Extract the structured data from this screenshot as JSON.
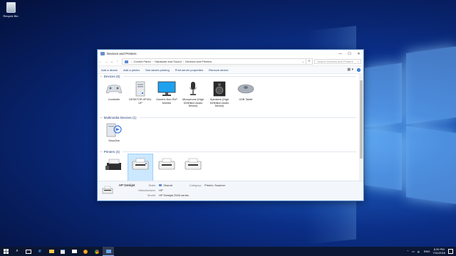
{
  "desktop": {
    "recycle_bin_label": "Recycle Bin"
  },
  "window": {
    "title": "Devices and Printers",
    "controls": {
      "minimize": "—",
      "maximize": "☐",
      "close": "✕"
    },
    "breadcrumb": [
      "Control Panel",
      "Hardware and Sound",
      "Devices and Printers"
    ],
    "search_placeholder": "Search Devices and Printers",
    "toolbar": [
      "Add a device",
      "Add a printer",
      "See what's printing",
      "Print server properties",
      "Remove device"
    ],
    "groups": {
      "devices": {
        "title": "Devices (6)",
        "items": [
          {
            "label": "Controller",
            "icon": "gamepad-icon"
          },
          {
            "label": "DESKTOP-HF9GL UP",
            "icon": "computer-tower-icon"
          },
          {
            "label": "Generic Non-PnP Monitor",
            "icon": "monitor-icon"
          },
          {
            "label": "Microphone (High Definition Audio Device)",
            "icon": "microphone-icon"
          },
          {
            "label": "Speakers (High Definition Audio Device)",
            "icon": "speaker-icon"
          },
          {
            "label": "USB Tablet",
            "icon": "mouse-icon"
          }
        ]
      },
      "multimedia": {
        "title": "Multimedia Devices (1)",
        "items": [
          {
            "label": "XboxOne",
            "icon": "media-device-icon"
          }
        ]
      },
      "printers": {
        "title": "Printers (4)",
        "items": [
          {
            "label": "",
            "icon": "fax-icon"
          },
          {
            "label": "",
            "icon": "printer-icon"
          },
          {
            "label": "",
            "icon": "printer-icon"
          },
          {
            "label": "",
            "icon": "printer-icon"
          }
        ]
      }
    },
    "details": {
      "name": "HP Deskjet",
      "state_label": "State:",
      "state_value": "Shared",
      "manufacturer_label": "Manufacturer:",
      "manufacturer_value": "HP",
      "model_label": "Model:",
      "model_value": "HP Deskjet 2540 series",
      "category_label": "Category:",
      "category_value": "Printer; Scanner"
    }
  },
  "taskbar": {
    "language": "ENG",
    "time": "8:39 PM",
    "date": "7/11/2016"
  },
  "colors": {
    "accent": "#1f6fd6",
    "selection": "#cce8ff",
    "taskbar": "#0c1630"
  }
}
